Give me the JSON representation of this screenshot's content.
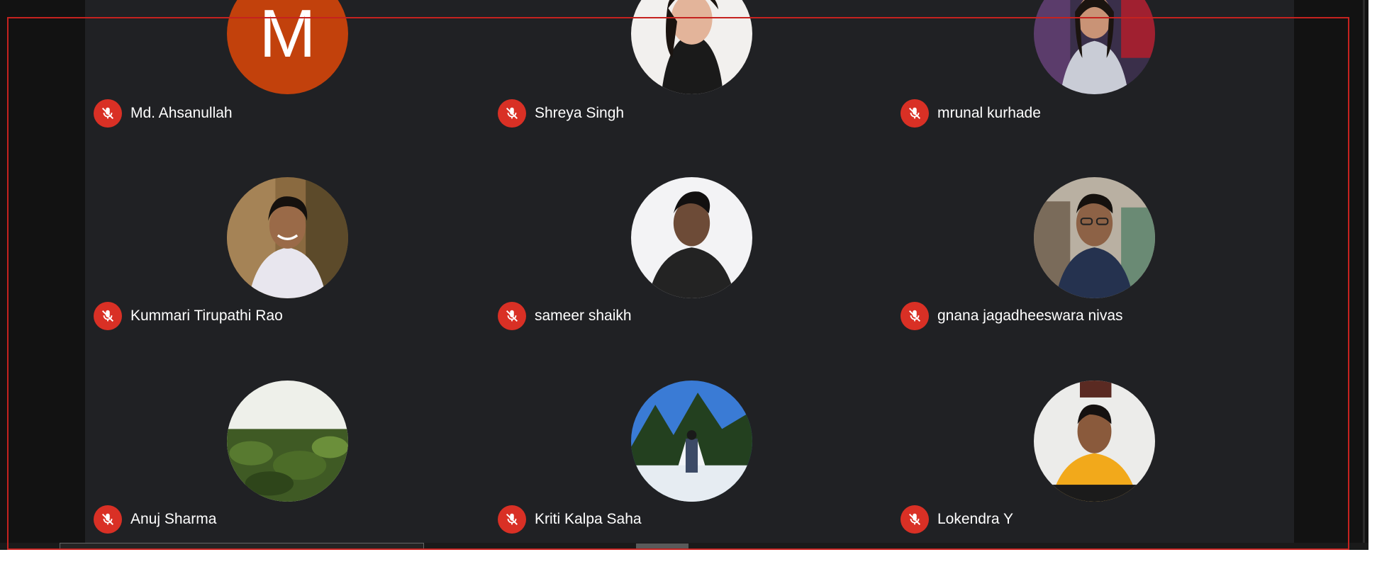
{
  "participants": [
    {
      "name": "Md. Ahsanullah",
      "avatar": "letter",
      "initial": "M"
    },
    {
      "name": "Shreya Singh",
      "avatar": "photo"
    },
    {
      "name": "mrunal kurhade",
      "avatar": "photo"
    },
    {
      "name": "Kummari Tirupathi Rao",
      "avatar": "photo"
    },
    {
      "name": "sameer shaikh",
      "avatar": "photo"
    },
    {
      "name": "gnana jagadheeswara nivas",
      "avatar": "photo"
    },
    {
      "name": "Anuj Sharma",
      "avatar": "photo"
    },
    {
      "name": "Kriti Kalpa Saha",
      "avatar": "photo"
    },
    {
      "name": "Lokendra Y",
      "avatar": "photo"
    }
  ],
  "icons": {
    "mute": "mic-off-icon"
  },
  "colors": {
    "tile_bg": "#202124",
    "mute_badge": "#d93025",
    "letter_avatar": "#c2410c",
    "selection_outline": "#c5221f"
  }
}
